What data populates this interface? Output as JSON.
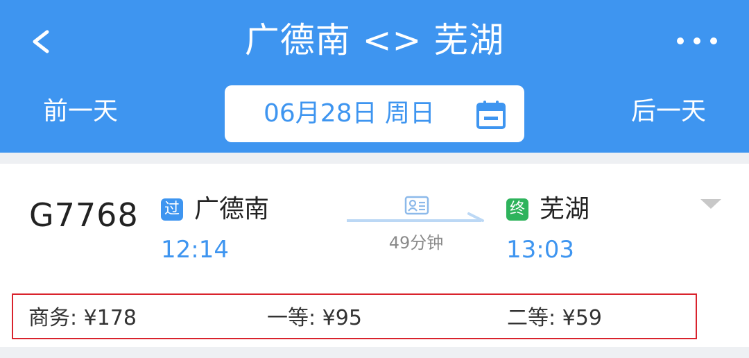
{
  "header": {
    "title": "广德南 <> 芜湖",
    "prev_day": "前一天",
    "next_day": "后一天",
    "date": "06月28日 周日"
  },
  "train": {
    "number": "G7768",
    "from_badge": "过",
    "from_station": "广德南",
    "depart_time": "12:14",
    "to_badge": "终",
    "to_station": "芜湖",
    "arrive_time": "13:03",
    "duration": "49分钟"
  },
  "prices": {
    "business": "商务: ¥178",
    "first_class": "一等: ¥95",
    "second_class": "二等: ¥59"
  },
  "icons": {
    "back": "back-arrow-icon",
    "more": "more-icon",
    "calendar": "calendar-icon",
    "id_card": "id-card-icon",
    "expand": "chevron-down-icon"
  },
  "colors": {
    "accent": "#3e95f0",
    "terminal_badge": "#2eb35c",
    "highlight_border": "#d9232d"
  }
}
